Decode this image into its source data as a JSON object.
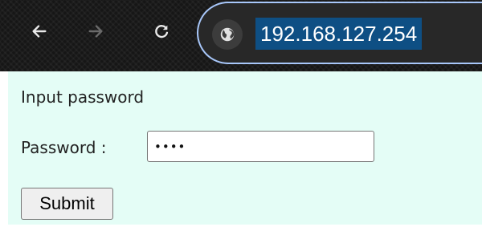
{
  "browser": {
    "url": "192.168.127.254",
    "back_icon": "arrow-left-icon",
    "forward_icon": "arrow-right-icon",
    "reload_icon": "reload-icon",
    "site_info_icon": "globe-icon"
  },
  "page": {
    "heading": "Input password",
    "password_label": "Password :",
    "password_value": "1234",
    "submit_label": "Submit"
  },
  "colors": {
    "page_background": "#e4fdf6",
    "url_selection": "#0e4f84",
    "omnibox_focus": "#a8c7fa"
  }
}
